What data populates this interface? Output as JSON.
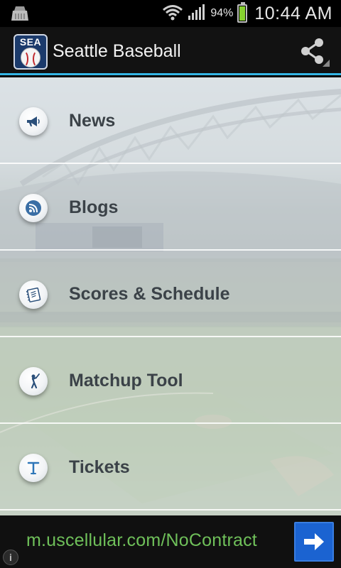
{
  "status_bar": {
    "battery_percent": "94%",
    "time": "10:44 AM",
    "icons": [
      "notification-icon",
      "wifi-icon",
      "signal-icon",
      "battery-icon"
    ]
  },
  "action_bar": {
    "logo_text": "SEA",
    "title": "Seattle Baseball",
    "share_icon": "share-icon"
  },
  "menu": {
    "items": [
      {
        "label": "News",
        "icon": "megaphone-icon"
      },
      {
        "label": "Blogs",
        "icon": "rss-icon"
      },
      {
        "label": "Scores & Schedule",
        "icon": "notebook-icon"
      },
      {
        "label": "Matchup Tool",
        "icon": "batter-icon"
      },
      {
        "label": "Tickets",
        "icon": "ticket-t-icon"
      }
    ]
  },
  "ad": {
    "text": "m.uscellular.com/NoContract",
    "info_label": "i",
    "arrow_icon": "arrow-right-icon"
  },
  "colors": {
    "action_bar_accent": "#33b5e5",
    "ad_text": "#6fc05a",
    "ad_button": "#1b63d1",
    "menu_text": "#3b4248"
  }
}
